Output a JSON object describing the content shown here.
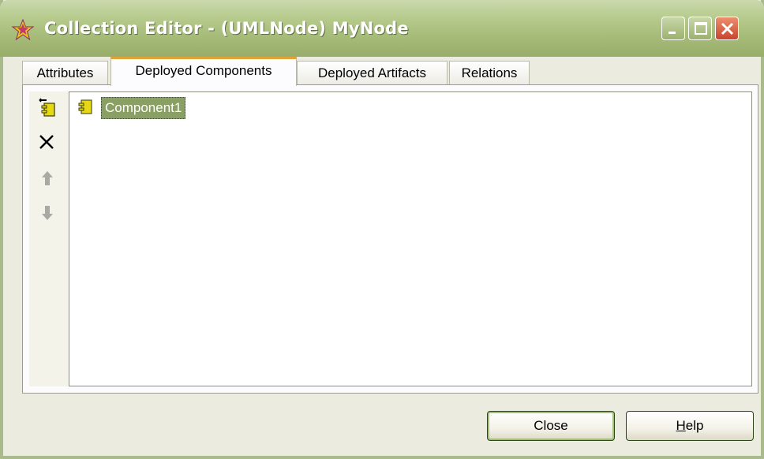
{
  "window": {
    "title": "Collection Editor - (UMLNode) MyNode",
    "icons": {
      "app": "star-icon",
      "minimize": "minimize-icon",
      "maximize": "maximize-icon",
      "close": "close-icon"
    }
  },
  "tabs": [
    {
      "label": "Attributes",
      "active": false
    },
    {
      "label": "Deployed Components",
      "active": true
    },
    {
      "label": "Deployed Artifacts",
      "active": false
    },
    {
      "label": "Relations",
      "active": false
    }
  ],
  "toolbar": {
    "items": [
      {
        "name": "add-component-icon",
        "enabled": true
      },
      {
        "name": "delete-icon",
        "enabled": true
      },
      {
        "name": "move-up-icon",
        "enabled": false
      },
      {
        "name": "move-down-icon",
        "enabled": false
      }
    ]
  },
  "list": {
    "items": [
      {
        "label": "Component1",
        "icon": "component-icon",
        "selected": true
      }
    ]
  },
  "buttons": {
    "close_label": "Close",
    "help_label_mnemonic": "H",
    "help_label_rest": "elp"
  },
  "colors": {
    "titlebar": "#a3b975",
    "selection": "#8a9f63",
    "active_tab_accent": "#e2a23a"
  }
}
